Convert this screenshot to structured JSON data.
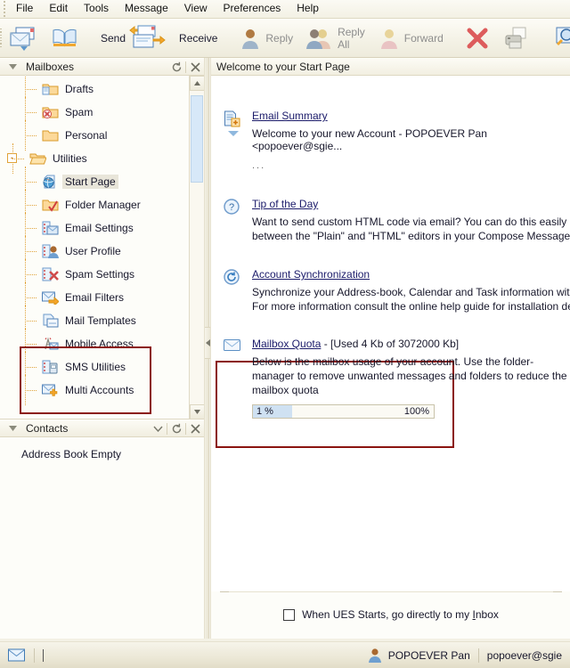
{
  "menubar": {
    "items": [
      {
        "label": "File"
      },
      {
        "label": "Edit"
      },
      {
        "label": "Tools"
      },
      {
        "label": "Message"
      },
      {
        "label": "View"
      },
      {
        "label": "Preferences"
      },
      {
        "label": "Help"
      }
    ]
  },
  "toolbar": {
    "buttons": [
      {
        "name": "new-message-button",
        "label": "",
        "icon": "new-message-icon"
      },
      {
        "name": "address-book-button",
        "label": "",
        "icon": "address-book-icon"
      },
      {
        "name": "send-button",
        "label": "Send",
        "icon": "send-icon"
      },
      {
        "name": "receive-button",
        "label": "Receive",
        "icon": "receive-icon"
      },
      {
        "name": "reply-button",
        "label": "Reply",
        "icon": "reply-icon"
      },
      {
        "name": "reply-all-button",
        "label": "Reply All",
        "icon": "reply-all-icon"
      },
      {
        "name": "forward-button",
        "label": "Forward",
        "icon": "forward-icon"
      },
      {
        "name": "delete-button",
        "label": "",
        "icon": "delete-x-icon"
      },
      {
        "name": "print-button",
        "label": "",
        "icon": "printer-icon"
      },
      {
        "name": "search-button",
        "label": "",
        "icon": "search-mail-icon"
      }
    ],
    "send_label": "Send",
    "receive_label": "Receive",
    "reply_label": "Reply",
    "reply_all_label": "Reply All",
    "forward_label": "Forward"
  },
  "mailboxes_panel": {
    "title": "Mailboxes",
    "refresh_icon": "refresh-icon",
    "close_icon": "close-icon",
    "tree": [
      {
        "label": "Drafts",
        "icon": "folder-drafts-icon",
        "level": 2,
        "selected": false
      },
      {
        "label": "Spam",
        "icon": "folder-spam-icon",
        "level": 2,
        "selected": false
      },
      {
        "label": "Personal",
        "icon": "folder-icon",
        "level": 2,
        "selected": false
      },
      {
        "label": "Utilities",
        "icon": "folder-open-icon",
        "level": 1,
        "selected": false,
        "expander": "-"
      },
      {
        "label": "Start Page",
        "icon": "globe-page-icon",
        "level": 2,
        "selected": true
      },
      {
        "label": "Folder Manager",
        "icon": "folder-check-icon",
        "level": 2,
        "selected": false
      },
      {
        "label": "Email Settings",
        "icon": "email-settings-icon",
        "level": 2,
        "selected": false
      },
      {
        "label": "User Profile",
        "icon": "user-profile-icon",
        "level": 2,
        "selected": false
      },
      {
        "label": "Spam Settings",
        "icon": "spam-settings-icon",
        "level": 2,
        "selected": false
      },
      {
        "label": "Email Filters",
        "icon": "email-filters-icon",
        "level": 2,
        "selected": false
      },
      {
        "label": "Mail Templates",
        "icon": "mail-templates-icon",
        "level": 2,
        "selected": false
      },
      {
        "label": "Mobile Access",
        "icon": "mobile-access-icon",
        "level": 2,
        "selected": false
      },
      {
        "label": "SMS Utilities",
        "icon": "sms-utilities-icon",
        "level": 2,
        "selected": false
      },
      {
        "label": "Multi Accounts",
        "icon": "multi-accounts-icon",
        "level": 2,
        "selected": false
      }
    ]
  },
  "contacts_panel": {
    "title": "Contacts",
    "empty_text": "Address Book Empty",
    "chevron_icon": "chevron-down-icon",
    "refresh_icon": "refresh-icon",
    "close_icon": "close-icon"
  },
  "main": {
    "header_title": "Welcome to your Start Page",
    "sections": [
      {
        "id": "email-summary",
        "title": "Email Summary",
        "icon": "summary-page-icon",
        "row_text": "Welcome to your new Account - POPOEVER Pan <popoever@sgie...",
        "ellipsis": "..."
      },
      {
        "id": "tip-of-the-day",
        "title": "Tip of the Day",
        "icon": "question-circle-icon",
        "body": "Want to send custom HTML code via email? You can do this easily by toggling between the \"Plain\" and \"HTML\" editors in your Compose Message Window"
      },
      {
        "id": "account-synchronization",
        "title": "Account Synchronization",
        "icon": "sync-circle-icon",
        "body": "Synchronize your Address-book, Calendar and Task information with Outlook. For more information consult the online help guide for installation details"
      },
      {
        "id": "mailbox-quota",
        "title": "Mailbox Quota",
        "suffix": " - [Used 4 Kb of 3072000 Kb]",
        "icon": "envelope-icon",
        "body": "Below is the mailbox usage of your account. Use the folder-manager to remove unwanted messages and folders to reduce the mailbox quota",
        "progress_left": "1 %",
        "progress_right": "100%",
        "progress_percent": 1
      }
    ],
    "footer_checkbox": {
      "checked": false,
      "prefix": "When UES Starts, go directly to my ",
      "underlined": "I",
      "suffix": "nbox"
    }
  },
  "statusbar": {
    "mail_icon": "envelope-icon",
    "message": "",
    "user_icon": "user-avatar-icon",
    "user_name": "POPOEVER Pan",
    "user_email": "popoever@sgie"
  },
  "colors": {
    "annotation_red": "#8b1410",
    "link_blue": "#1b1b6a",
    "progress_fill": "#cfe1f2",
    "scroll_thumb": "#d7e8f8",
    "tree_dots": "#e0a33a"
  }
}
